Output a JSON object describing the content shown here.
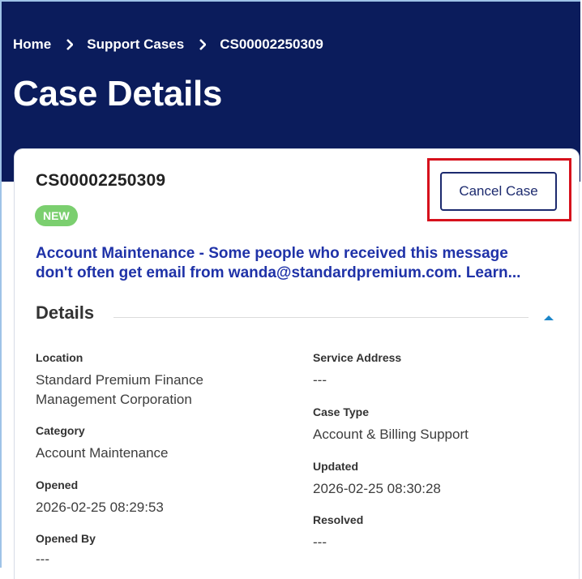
{
  "breadcrumb": {
    "items": [
      "Home",
      "Support Cases",
      "CS00002250309"
    ]
  },
  "page_title": "Case Details",
  "case": {
    "number": "CS00002250309",
    "status": "NEW",
    "description_line1": "Account Maintenance - Some people who received this message",
    "description_line2": "don't often get email from wanda@standardpremium.com. Learn..."
  },
  "actions": {
    "cancel_label": "Cancel Case"
  },
  "details": {
    "title": "Details",
    "left": [
      {
        "label": "Location",
        "value_line1": "Standard Premium Finance",
        "value_line2": "Management Corporation"
      },
      {
        "label": "Category",
        "value": "Account Maintenance"
      },
      {
        "label": "Opened",
        "value": "2026-02-25 08:29:53"
      },
      {
        "label": "Opened By",
        "value": "---"
      }
    ],
    "right": [
      {
        "label": "Service Address",
        "value": "---"
      },
      {
        "label": "Case Type",
        "value": "Account & Billing Support"
      },
      {
        "label": "Updated",
        "value": "2026-02-25 08:30:28"
      },
      {
        "label": "Resolved",
        "value": "---"
      }
    ]
  },
  "colors": {
    "header_bg": "#0b1c5c",
    "link_blue": "#1f32a8",
    "badge_green": "#7bcf6f",
    "highlight_red": "#d6111c"
  },
  "icons": [
    "chevron-right-icon",
    "chevron-up-icon"
  ]
}
